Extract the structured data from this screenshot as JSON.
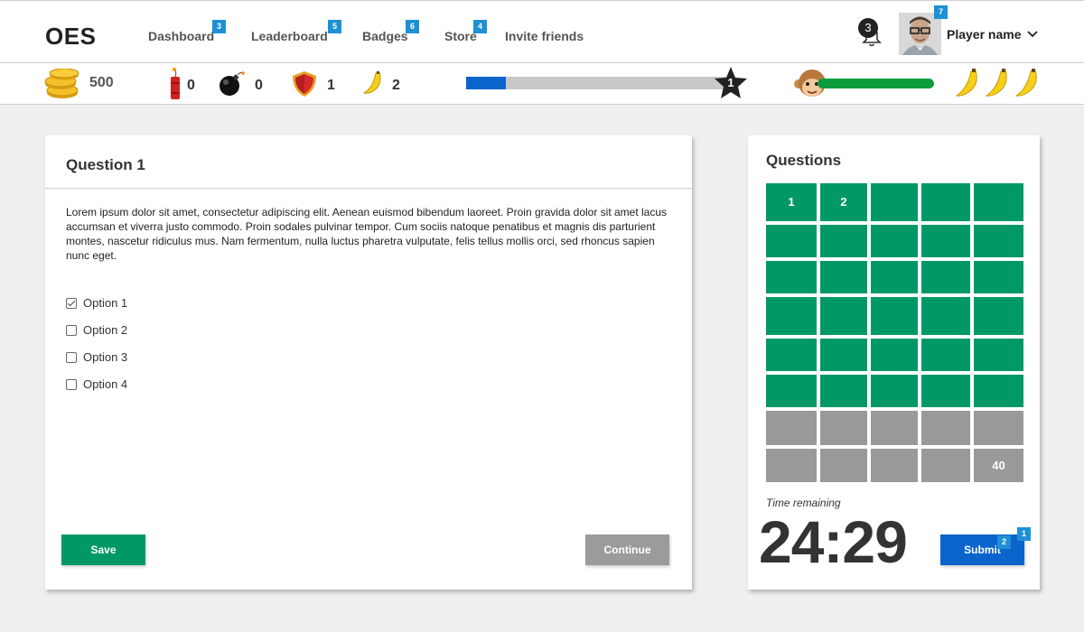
{
  "app": {
    "logo": "OES"
  },
  "nav": {
    "items": [
      {
        "label": "Dashboard",
        "badge": "3"
      },
      {
        "label": "Leaderboard",
        "badge": "5"
      },
      {
        "label": "Badges",
        "badge": "6"
      },
      {
        "label": "Store",
        "badge": "4"
      },
      {
        "label": "Invite friends",
        "badge": ""
      }
    ],
    "notifications": "3",
    "avatar_badge": "7",
    "player_name": "Player name"
  },
  "stats": {
    "coins": "500",
    "dynamite": "0",
    "bombs": "0",
    "shields": "1",
    "bananas": "2",
    "level": "1",
    "level_progress": 0.15,
    "health": 1.0,
    "lives": 3
  },
  "question": {
    "title": "Question 1",
    "text": "Lorem ipsum dolor sit amet, consectetur adipiscing elit. Aenean euismod bibendum laoreet. Proin gravida dolor sit amet lacus accumsan et viverra justo commodo. Proin sodales pulvinar tempor. Cum sociis natoque penatibus et magnis dis parturient montes, nascetur ridiculus mus. Nam fermentum, nulla luctus pharetra vulputate, felis tellus mollis orci, sed rhoncus sapien nunc eget.",
    "options": [
      {
        "label": "Option 1",
        "checked": true
      },
      {
        "label": "Option 2",
        "checked": false
      },
      {
        "label": "Option 3",
        "checked": false
      },
      {
        "label": "Option 4",
        "checked": false
      }
    ],
    "save_label": "Save",
    "continue_label": "Continue"
  },
  "questions_panel": {
    "title": "Questions",
    "total": 40,
    "answered": 30,
    "labels": {
      "1": "1",
      "2": "2",
      "40": "40"
    },
    "time_label": "Time remaining",
    "timer": "24:29",
    "submit_label": "Submit",
    "submit_badges": [
      "2",
      "1"
    ]
  },
  "colors": {
    "answered": "#009966",
    "unanswered": "#999999",
    "save": "#009966",
    "continue": "#9b9b9b",
    "submit": "#0a64cc",
    "badge": "#1e90d6"
  }
}
